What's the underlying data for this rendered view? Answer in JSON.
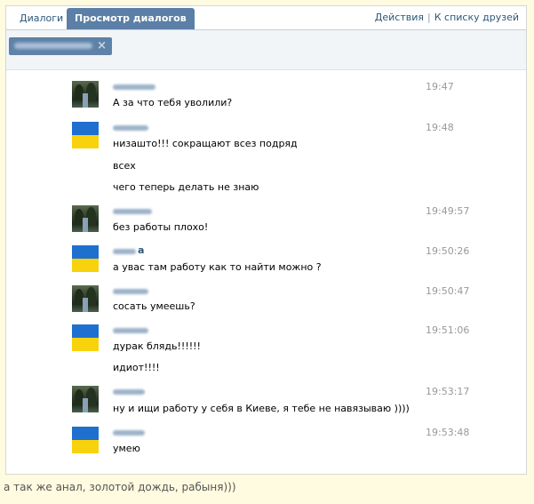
{
  "tabs": {
    "dialogs": "Диалоги",
    "view_dialogs": "Просмотр диалогов"
  },
  "top_links": {
    "actions": "Действия",
    "separator": "|",
    "friends": "К списку друзей"
  },
  "filter_chip": {
    "close_glyph": "×"
  },
  "messages": [
    {
      "avatar": "forest-photo",
      "time": "19:47",
      "lines": [
        "А за что тебя уволили?"
      ]
    },
    {
      "avatar": "ukraine-flag",
      "time": "19:48",
      "lines": [
        "низашто!!! сокращают всез подряд",
        "всех",
        "чего теперь делать не знаю"
      ]
    },
    {
      "avatar": "forest-photo",
      "time": "19:49:57",
      "lines": [
        "без работы плохо!"
      ]
    },
    {
      "avatar": "ukraine-flag",
      "time": "19:50:26",
      "name_suffix": "а",
      "lines": [
        "а увас там работу как то найти можно ?"
      ]
    },
    {
      "avatar": "forest-photo",
      "time": "19:50:47",
      "lines": [
        "сосать умеешь?"
      ]
    },
    {
      "avatar": "ukraine-flag",
      "time": "19:51:06",
      "lines": [
        "дурак блядь!!!!!!",
        "идиот!!!!"
      ]
    },
    {
      "avatar": "forest-photo",
      "time": "19:53:17",
      "lines": [
        "ну и ищи работу у себя в Киеве, я тебе не навязываю ))))"
      ]
    },
    {
      "avatar": "ukraine-flag",
      "time": "19:53:48",
      "lines": [
        "умею"
      ]
    }
  ],
  "caption": "а так же анал, золотой дождь, рабыня)))",
  "colors": {
    "accent": "#5b7fa6",
    "link": "#2b587a",
    "flag_blue": "#1f6fcf",
    "flag_yellow": "#f8d20c",
    "page_bg": "#fffbe0"
  }
}
